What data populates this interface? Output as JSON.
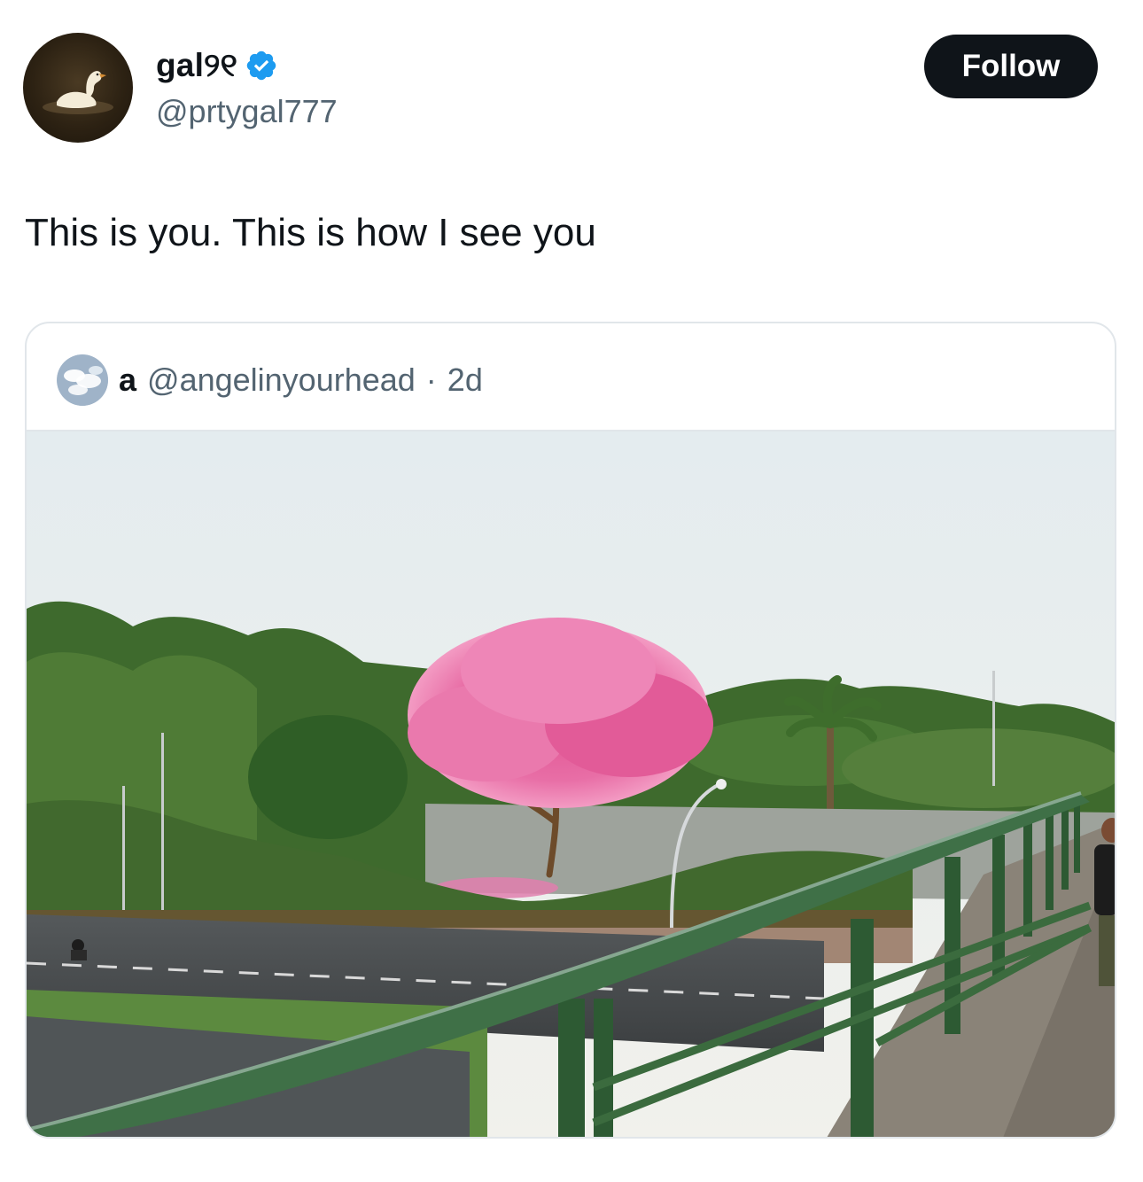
{
  "author": {
    "display_name": "gal୨୧",
    "handle": "@prtygal777",
    "avatar_icon": "swan-avatar",
    "verified_icon": "verified-badge-icon",
    "verified_color": "#1d9bf0"
  },
  "follow_button": {
    "label": "Follow",
    "background": "#0f1419",
    "text_color": "#ffffff"
  },
  "tweet": {
    "text": "This is you. This is how I see you"
  },
  "quoted_tweet": {
    "display_name": "a",
    "handle": "@angelinyourhead",
    "separator": "·",
    "time": "2d",
    "avatar_icon": "cloud-sky-avatar",
    "media_icon": "photo-pink-tree-overpass"
  },
  "colors": {
    "text_primary": "#0f1419",
    "text_secondary": "#536471",
    "border": "#e1e6ea"
  }
}
